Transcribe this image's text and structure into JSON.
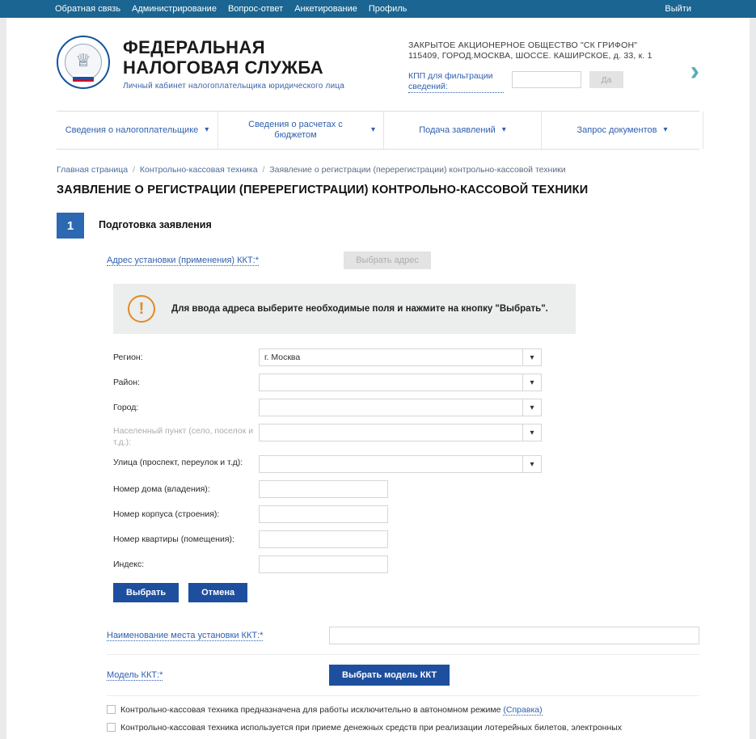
{
  "topbar": {
    "links": [
      {
        "label": "Обратная связь"
      },
      {
        "label": "Администрирование"
      },
      {
        "label": "Вопрос-ответ"
      },
      {
        "label": "Анкетирование"
      },
      {
        "label": "Профиль"
      }
    ],
    "logout": "Выйти"
  },
  "brand": {
    "line1": "ФЕДЕРАЛЬНАЯ",
    "line2": "НАЛОГОВАЯ СЛУЖБА",
    "subtitle": "Личный кабинет налогоплательщика юридического лица",
    "emblem_icon": "double-headed-eagle-icon"
  },
  "org": {
    "name": "ЗАКРЫТОЕ АКЦИОНЕРНОЕ ОБЩЕСТВО \"СК ГРИФОН\"",
    "address": "115409, ГОРОД.МОСКВА, ШОССЕ. КАШИРСКОЕ, д. 33, к. 1",
    "kpp_label": "КПП для фильтрации сведений:",
    "kpp_value": "",
    "kpp_placeholder": "",
    "kpp_submit": "Да",
    "next_icon": "chevron-right-icon"
  },
  "nav": {
    "items": [
      {
        "label": "Сведения о налогоплательщике",
        "caret": "chevron-down-icon"
      },
      {
        "label": "Сведения о расчетах с бюджетом",
        "caret": "chevron-down-icon"
      },
      {
        "label": "Подача заявлений",
        "caret": "chevron-down-icon"
      },
      {
        "label": "Запрос документов",
        "caret": "chevron-down-icon"
      }
    ]
  },
  "breadcrumb": {
    "items": [
      "Главная страница",
      "Контрольно-кассовая техника",
      "Заявление о регистрации (перерегистрации) контрольно-кассовой техники"
    ],
    "separator": "/"
  },
  "page_title": "ЗАЯВЛЕНИЕ О РЕГИСТРАЦИИ (ПЕРЕРЕГИСТРАЦИИ) КОНТРОЛЬНО-КАССОВОЙ ТЕХНИКИ",
  "step": {
    "number": "1",
    "title": "Подготовка заявления"
  },
  "address_section": {
    "label": "Адрес установки (применения) ККТ:*",
    "choose_button": "Выбрать адрес",
    "alert": {
      "icon": "exclamation-circle-icon",
      "text": "Для ввода адреса выберите необходимые поля и нажмите на кнопку \"Выбрать\"."
    },
    "fields": [
      {
        "label": "Регион:",
        "value": "г. Москва",
        "type": "select",
        "muted": false
      },
      {
        "label": "Район:",
        "value": "",
        "type": "select",
        "muted": false
      },
      {
        "label": "Город:",
        "value": "",
        "type": "select",
        "muted": false
      },
      {
        "label": "Населенный пункт (село, поселок и т.д.):",
        "value": "",
        "type": "select",
        "muted": true
      },
      {
        "label": "Улица (проспект, переулок и т.д):",
        "value": "",
        "type": "select",
        "muted": false
      },
      {
        "label": "Номер дома (владения):",
        "value": "",
        "type": "text",
        "muted": false
      },
      {
        "label": "Номер корпуса (строения):",
        "value": "",
        "type": "text",
        "muted": false
      },
      {
        "label": "Номер квартиры (помещения):",
        "value": "",
        "type": "text",
        "muted": false
      },
      {
        "label": "Индекс:",
        "value": "",
        "type": "text",
        "muted": false
      }
    ],
    "submit_button": "Выбрать",
    "cancel_button": "Отмена"
  },
  "place_name": {
    "label": "Наименование места установки ККТ:*",
    "value": ""
  },
  "model": {
    "label": "Модель ККТ:*",
    "button": "Выбрать модель ККТ"
  },
  "checkboxes": [
    {
      "text": "Контрольно-кассовая техника предназначена для работы исключительно в автономном режиме",
      "link": "(Справка)",
      "checked": false
    },
    {
      "text": "Контрольно-кассовая техника используется при приеме денежных средств при реализации лотерейных билетов, электронных",
      "link": "",
      "checked": false
    }
  ],
  "colors": {
    "topbar": "#1a6591",
    "link_blue": "#2f5fae",
    "button_blue": "#1d4f9e",
    "step_blue": "#2d68b2",
    "alert_orange": "#e08a24",
    "arrow_teal": "#56aeb4"
  }
}
